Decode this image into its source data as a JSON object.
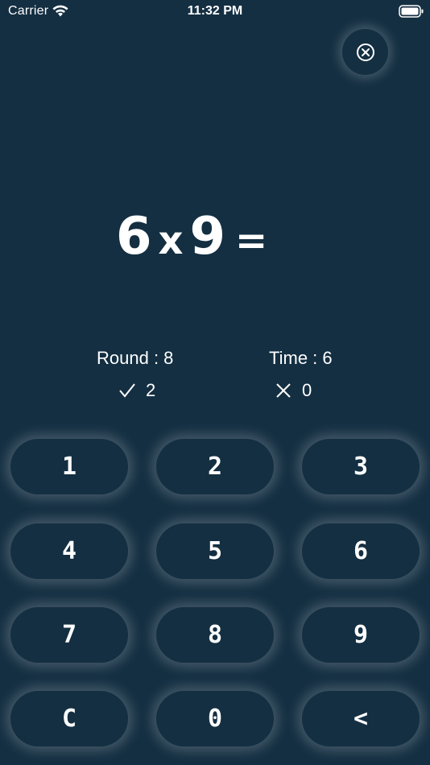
{
  "status_bar": {
    "carrier": "Carrier",
    "time": "11:32 PM"
  },
  "question": {
    "left_operand": "6",
    "operator": "x",
    "right_operand": "9",
    "equals": "="
  },
  "stats": {
    "round": "Round : 8",
    "time": "Time : 6",
    "correct": "2",
    "wrong": "0"
  },
  "keypad": {
    "keys": [
      "1",
      "2",
      "3",
      "4",
      "5",
      "6",
      "7",
      "8",
      "9",
      "C",
      "0",
      "<"
    ]
  },
  "colors": {
    "background": "#142f42",
    "text": "#ffffff",
    "glow": "#ffffff"
  },
  "icons": {
    "close": "close-circle-icon",
    "correct": "checkmark-icon",
    "wrong": "x-mark-icon",
    "wifi": "wifi-icon",
    "battery": "battery-icon"
  }
}
